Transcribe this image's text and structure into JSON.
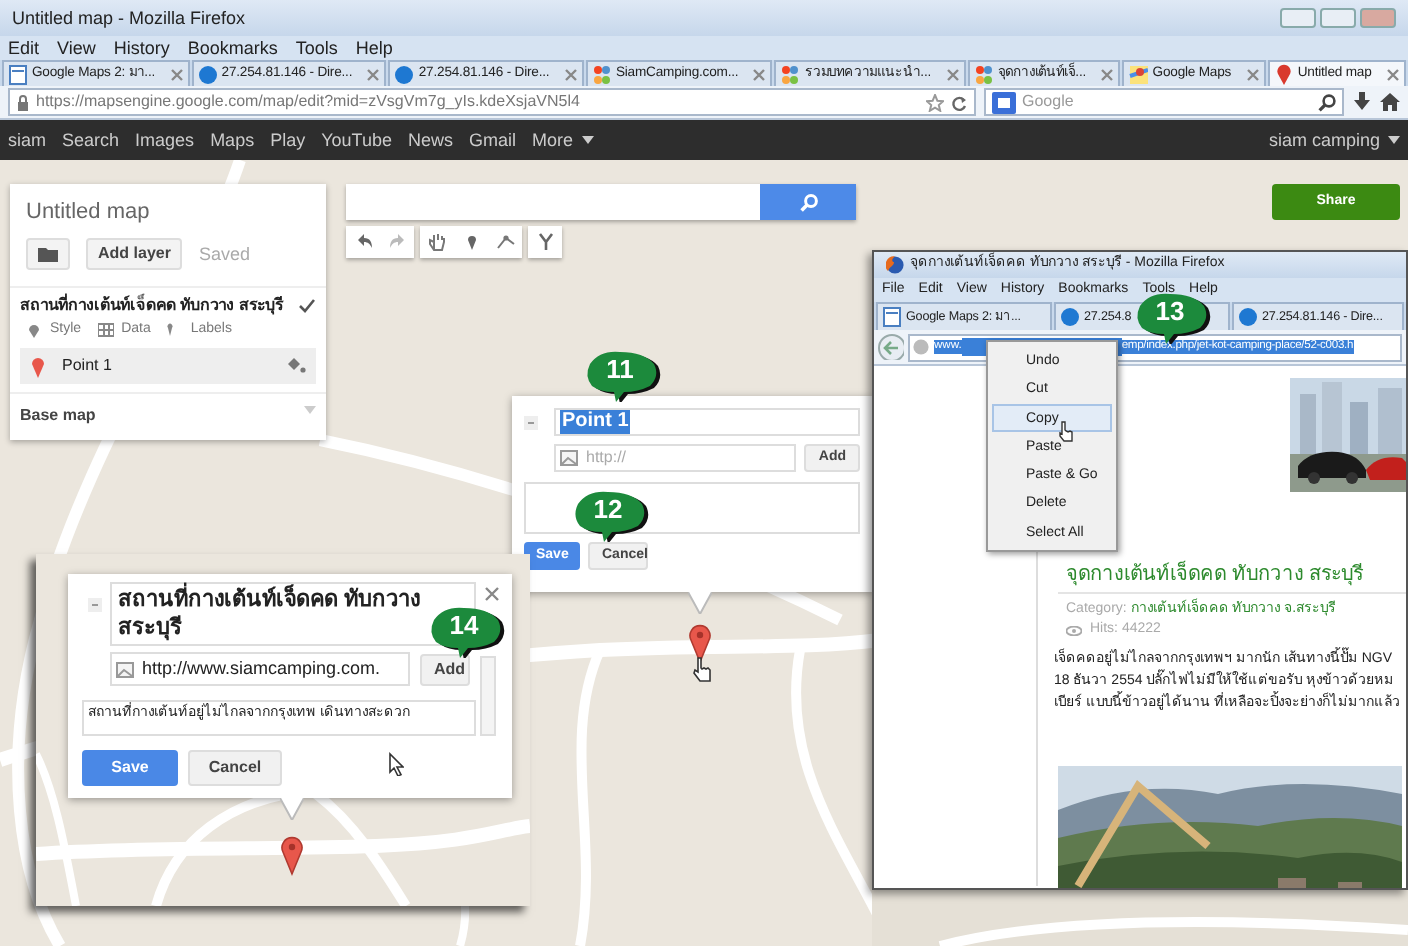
{
  "window": {
    "title": "Untitled map - Mozilla Firefox"
  },
  "menu": [
    "Edit",
    "View",
    "History",
    "Bookmarks",
    "Tools",
    "Help"
  ],
  "tabs": [
    {
      "label": "Google Maps 2: มา...",
      "kind": "doc",
      "selected": false
    },
    {
      "label": "27.254.81.146 - Dire...",
      "kind": "globe",
      "selected": false
    },
    {
      "label": "27.254.81.146 - Dire...",
      "kind": "globe",
      "selected": false
    },
    {
      "label": "SiamCamping.com...",
      "kind": "joomla",
      "selected": false
    },
    {
      "label": "รวมบทความแนะนำ...",
      "kind": "joomla",
      "selected": false
    },
    {
      "label": "จุดกางเต้นท์เจ็...",
      "kind": "joomla",
      "selected": false
    },
    {
      "label": "Google Maps",
      "kind": "maps",
      "selected": false
    },
    {
      "label": "Untitled map",
      "kind": "pin",
      "selected": true
    }
  ],
  "address_bar": {
    "url": "https://mapsengine.google.com/map/edit?mid=zVsgVm7g_yIs.kdeXsjaVN5l4",
    "search_placeholder": "Google"
  },
  "google_bar": {
    "links": [
      "siam",
      "Search",
      "Images",
      "Maps",
      "Play",
      "YouTube",
      "News",
      "Gmail",
      "More"
    ],
    "user": "siam camping"
  },
  "map_panel": {
    "title": "Untitled map",
    "add_layer": "Add layer",
    "status": "Saved",
    "layer": {
      "title": "สถานที่กางเต้นท์เจ็ดคด ทับกวาง สระบุรี",
      "checked": true,
      "tools": [
        {
          "label": "Style",
          "kind": "style"
        },
        {
          "label": "Data",
          "kind": "data"
        },
        {
          "label": "Labels",
          "kind": "labels"
        }
      ],
      "items": [
        {
          "label": "Point 1"
        }
      ]
    },
    "base_map": "Base map"
  },
  "share": "Share",
  "point_editor": {
    "title": "Point 1",
    "url_placeholder": "http://",
    "add": "Add",
    "save": "Save",
    "cancel": "Cancel",
    "callouts": [
      "11",
      "12"
    ]
  },
  "browser_inset": {
    "title": "จุดกางเต้นท์เจ็ดคด ทับกวาง สระบุรี - Mozilla Firefox",
    "menu": [
      "File",
      "Edit",
      "View",
      "History",
      "Bookmarks",
      "Tools",
      "Help"
    ],
    "tabs": [
      {
        "label": "Google Maps 2: มา...",
        "kind": "doc"
      },
      {
        "label": "27.254.8",
        "kind": "globe"
      },
      {
        "label": "27.254.81.146 - Dire...",
        "kind": "globe"
      }
    ],
    "url_start": "www.",
    "url_end": "emp/index.php/jet-kot-camping-place/52-c003.h",
    "callout": "13",
    "context_menu": [
      {
        "label": "Undo",
        "selected": false
      },
      {
        "label": "Cut",
        "selected": false
      },
      {
        "label": "Copy",
        "selected": true
      },
      {
        "label": "Paste",
        "selected": false
      },
      {
        "label": "Paste & Go",
        "selected": false
      },
      {
        "label": "Delete",
        "selected": false
      },
      {
        "label": "Select All",
        "selected": false
      }
    ],
    "article": {
      "heading": "จุดกางเต้นท์เจ็ดคด ทับกวาง สระบุรี",
      "category_label": "Category:",
      "category": "กางเต้นท์เจ็ดคด ทับกวาง จ.สระบุรี",
      "hits": "Hits: 44222",
      "paragraph": [
        "เจ็ดคดอยู่ไม่ไกลจากกรุงเทพฯ มากนัก เส้นทางนี้ปั๊ม NGV",
        "18 ธันวา 2554 ปลั๊กไฟไม่มีให้ใช้แต่ขอรับ หุงข้าวด้วยหม",
        "เบียร์ แบบนี้ข้าวอยู่ได้นาน ที่เหลือจะปิ้งจะย่างก็ไม่มากแล้ว"
      ]
    }
  },
  "zoom_inset": {
    "title": "สถานที่กางเต้นท์เจ็ดคด ทับกวาง สระบุรี",
    "url": "http://www.siamcamping.com.",
    "add": "Add",
    "description": "สถานที่กางเต้นท์อยู่ไม่ไกลจากกรุงเทพ เดินทางสะดวก",
    "save": "Save",
    "cancel": "Cancel",
    "callout": "14"
  }
}
